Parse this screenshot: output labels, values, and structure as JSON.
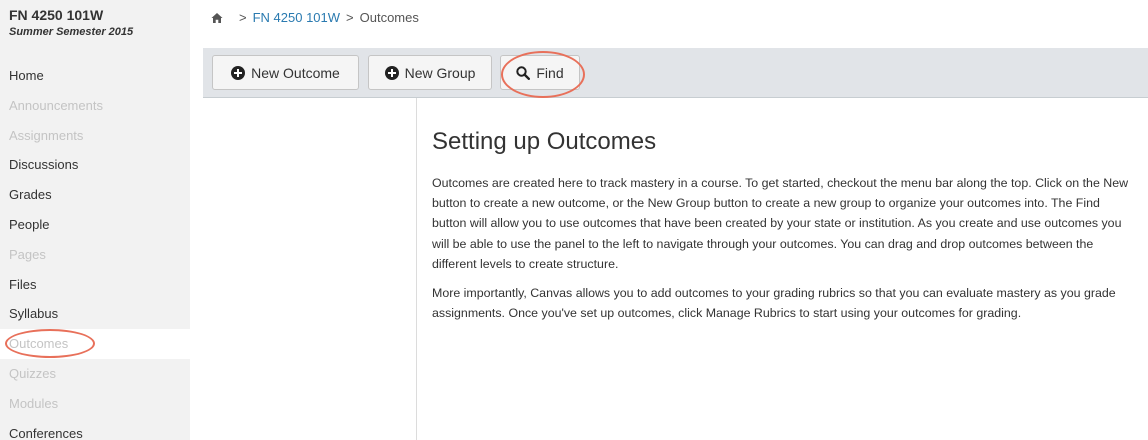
{
  "course": {
    "title": "FN 4250 101W",
    "term": "Summer Semester 2015"
  },
  "nav": [
    {
      "label": "Home",
      "state": "normal"
    },
    {
      "label": "Announcements",
      "state": "disabled"
    },
    {
      "label": "Assignments",
      "state": "disabled"
    },
    {
      "label": "Discussions",
      "state": "normal"
    },
    {
      "label": "Grades",
      "state": "normal"
    },
    {
      "label": "People",
      "state": "normal"
    },
    {
      "label": "Pages",
      "state": "disabled"
    },
    {
      "label": "Files",
      "state": "normal"
    },
    {
      "label": "Syllabus",
      "state": "normal"
    },
    {
      "label": "Outcomes",
      "state": "active"
    },
    {
      "label": "Quizzes",
      "state": "disabled"
    },
    {
      "label": "Modules",
      "state": "disabled"
    },
    {
      "label": "Conferences",
      "state": "normal"
    }
  ],
  "breadcrumb": {
    "home_icon": "home-icon",
    "separator": ">",
    "course": "FN 4250 101W",
    "current": "Outcomes"
  },
  "toolbar": {
    "new_outcome": "New Outcome",
    "new_group": "New Group",
    "find": "Find"
  },
  "main": {
    "heading": "Setting up Outcomes",
    "paragraph1": "Outcomes are created here to track mastery in a course. To get started, checkout the menu bar along the top. Click on the New button to create a new outcome, or the New Group button to create a new group to organize your outcomes into. The Find button will allow you to use outcomes that have been created by your state or institution. As you create and use outcomes you will be able to use the panel to the left to navigate through your outcomes. You can drag and drop outcomes between the different levels to create structure.",
    "paragraph2": "More importantly, Canvas allows you to add outcomes to your grading rubrics so that you can evaluate mastery as you grade assignments. Once you've set up outcomes, click Manage Rubrics to start using your outcomes for grading."
  },
  "colors": {
    "link": "#2a7ab0",
    "annotation": "#e8705a",
    "sidebar_bg": "#f2f2f2",
    "toolbar_bg": "#e1e4e8"
  }
}
